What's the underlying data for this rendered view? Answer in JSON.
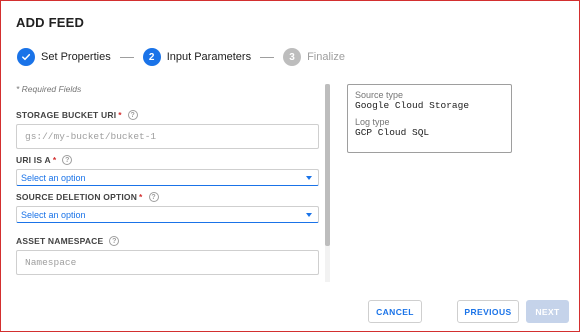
{
  "dialog": {
    "title": "ADD FEED"
  },
  "stepper": {
    "steps": [
      {
        "number": "1",
        "label": "Set Properties",
        "state": "done"
      },
      {
        "number": "2",
        "label": "Input Parameters",
        "state": "active"
      },
      {
        "number": "3",
        "label": "Finalize",
        "state": "pending"
      }
    ]
  },
  "form": {
    "required_note": "* Required Fields",
    "storage_bucket_uri": {
      "label": "STORAGE BUCKET URI",
      "required": "*",
      "placeholder": "gs://my-bucket/bucket-1"
    },
    "uri_is_a": {
      "label": "URI IS A",
      "required": "*",
      "value": "Select an option"
    },
    "source_deletion_option": {
      "label": "SOURCE DELETION OPTION",
      "required": "*",
      "value": "Select an option"
    },
    "asset_namespace": {
      "label": "ASSET NAMESPACE",
      "placeholder": "Namespace"
    }
  },
  "info": {
    "source_type_label": "Source type",
    "source_type_value": "Google Cloud Storage",
    "log_type_label": "Log type",
    "log_type_value": "GCP Cloud SQL"
  },
  "footer": {
    "cancel": "CANCEL",
    "previous": "PREVIOUS",
    "next": "NEXT"
  },
  "colors": {
    "accent": "#1a73e8",
    "required": "#d32f2f",
    "disabled": "#c5d3ea"
  }
}
